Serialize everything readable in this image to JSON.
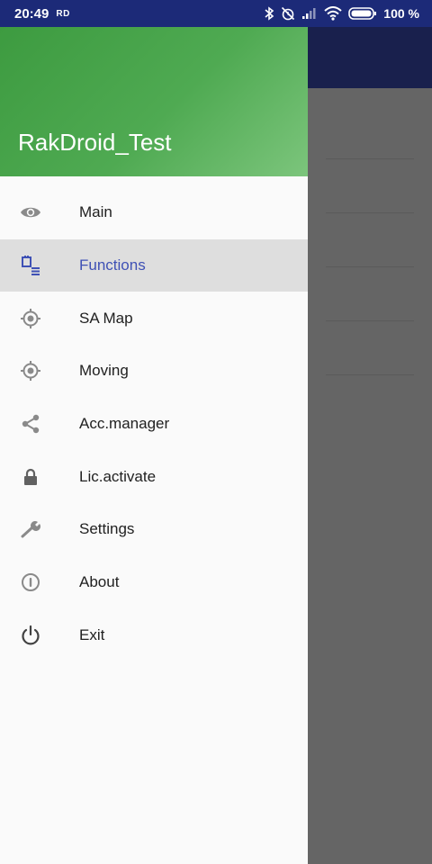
{
  "status_bar": {
    "time": "20:49",
    "carrier_badge": "RD",
    "battery_percent": "100 %",
    "icons": [
      "bluetooth-icon",
      "alarm-off-icon",
      "signal-icon",
      "wifi-icon",
      "battery-icon"
    ]
  },
  "drawer": {
    "header_title": "RakDroid_Test",
    "header_color": "#4caf50",
    "active_color": "#3f51b5",
    "items": [
      {
        "label": "Main",
        "icon": "eye-icon"
      },
      {
        "label": "Functions",
        "icon": "functions-icon",
        "active": true
      },
      {
        "label": "SA Map",
        "icon": "crosshair-icon"
      },
      {
        "label": "Moving",
        "icon": "crosshair-icon"
      },
      {
        "label": "Acc.manager",
        "icon": "share-icon"
      },
      {
        "label": "Lic.activate",
        "icon": "lock-icon"
      },
      {
        "label": "Settings",
        "icon": "wrench-icon"
      },
      {
        "label": "About",
        "icon": "info-icon"
      },
      {
        "label": "Exit",
        "icon": "power-icon"
      }
    ]
  }
}
